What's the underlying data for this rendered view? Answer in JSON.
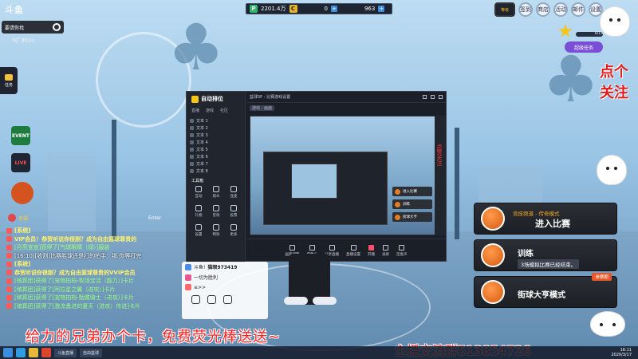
{
  "top_hud": {
    "points": "2201.4万",
    "coins": "0",
    "gems": "963"
  },
  "platform": {
    "logo": "斗鱼",
    "room_label": "要请你找",
    "room_sub": "阿门特2m"
  },
  "left_side": {
    "side_button": "任务",
    "event_label": "EVENT",
    "live_label": "LIVE",
    "player_name": "幸福"
  },
  "chat": {
    "enter_label": "Enter",
    "lines": [
      {
        "kind": "sys",
        "text": "[系统]"
      },
      {
        "kind": "sys",
        "text": "VIP会员！恭贺听说你很刚？成为自由篮球尊贵的"
      },
      {
        "kind": "green",
        "text": "[月亮宣宣]获得了[气球眼睛（绿）]服装"
      },
      {
        "kind": "white",
        "text": "[16:10][收割]比赛胜球还是打的拍手：那 你等打完"
      },
      {
        "kind": "sys",
        "text": "[系统]"
      },
      {
        "kind": "sys",
        "text": "恭贺听说你很刚？成为自由篮球尊贵的VVIP会员"
      },
      {
        "kind": "green",
        "text": "[殡葬团]获得了[宠物拍档-牧场宝活（能力）]卡片"
      },
      {
        "kind": "green",
        "text": "[殡葬团]获得了[阿拉星之翼（进攻）]卡片"
      },
      {
        "kind": "green",
        "text": "[殡葬团]获得了[宠物拍档-骷髅骑士（进攻）]卡片"
      },
      {
        "kind": "green",
        "text": "[殡葬团]获得了[激流勇进的夏天（进攻）传说]卡片"
      }
    ]
  },
  "window": {
    "logo": "自动排位",
    "tabs": [
      "直播",
      "游戏",
      "社区"
    ],
    "list": [
      "文本 1",
      "文本 2",
      "文本 3",
      "文本 4",
      "文本 5",
      "文本 6",
      "文本 7",
      "文本 8"
    ],
    "tools_head": "工具箱",
    "tools": [
      "互动",
      "观众",
      "连麦",
      "礼物",
      "音效",
      "投票",
      "设置",
      "特效",
      "更多"
    ],
    "topbar": "篮球SP - 比赛游戏设置",
    "sub_pill": "游戏 - 画面",
    "bottom": [
      "画面调整",
      "摄像头",
      "分享直播",
      "直播设置",
      "开播",
      "录屏",
      "连麦声"
    ],
    "preview_cards": [
      "进入比赛",
      "训练",
      "街球大亨"
    ]
  },
  "below_panel": {
    "stat": "斗鱼!",
    "stat_value": "猫眼973419",
    "row2": "一切为胜利",
    "row3": "≥>>"
  },
  "menu": [
    {
      "sub": "竞技频道 - 传奇模式",
      "title": "进入比赛",
      "desc": "",
      "tag": ""
    },
    {
      "sub": "",
      "title": "训练",
      "desc": "3场模拟比赛已经结束。",
      "tag": ""
    },
    {
      "sub": "",
      "title": "街球大亨模式",
      "desc": "",
      "tag": "参赛期"
    }
  ],
  "right_side": {
    "top_icons": [
      "等级",
      "签到",
      "商店",
      "活动",
      "邮件",
      "设置"
    ],
    "level": "6/15",
    "task_button": "超级任务",
    "vertical_text": "点个关注",
    "side_small": "点赞关注"
  },
  "banners": {
    "left": "给力的兄弟办个卡，免费荧光棒送送~",
    "right": "主播交流群513854726"
  },
  "taskbar": {
    "items": [
      "斗鱼直播",
      "自由篮球"
    ],
    "time": "16:11",
    "date": "2020/3/17"
  }
}
